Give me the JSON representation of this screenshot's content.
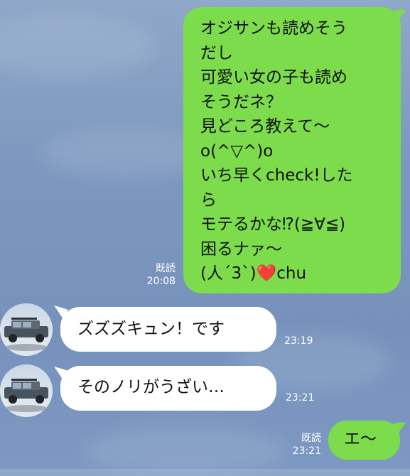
{
  "messages": [
    {
      "direction": "outgoing",
      "text": "オジサンも読めそう\nだし\n可愛い女の子も読め\nそうだネ？\n見どころ教えて〜\no(^▽^)o\nいち早くcheck!した\nら\nモテるかな⁉︎(≧∀≦)\n困るナァ〜\n(人´3`)❤️chu",
      "read_label": "既読",
      "time": "20:08"
    },
    {
      "direction": "incoming",
      "text": "ズズズキュン！です",
      "time": "23:19"
    },
    {
      "direction": "incoming",
      "text": "そのノリがうざい…",
      "time": "23:21"
    },
    {
      "direction": "outgoing",
      "text": "エ〜",
      "read_label": "既読",
      "time": "23:21"
    }
  ],
  "colors": {
    "outgoing_bubble": "#7ddc4b",
    "incoming_bubble": "#ffffff",
    "background": "#7d98bf"
  },
  "icons": {
    "avatar": "car-avatar-icon"
  }
}
